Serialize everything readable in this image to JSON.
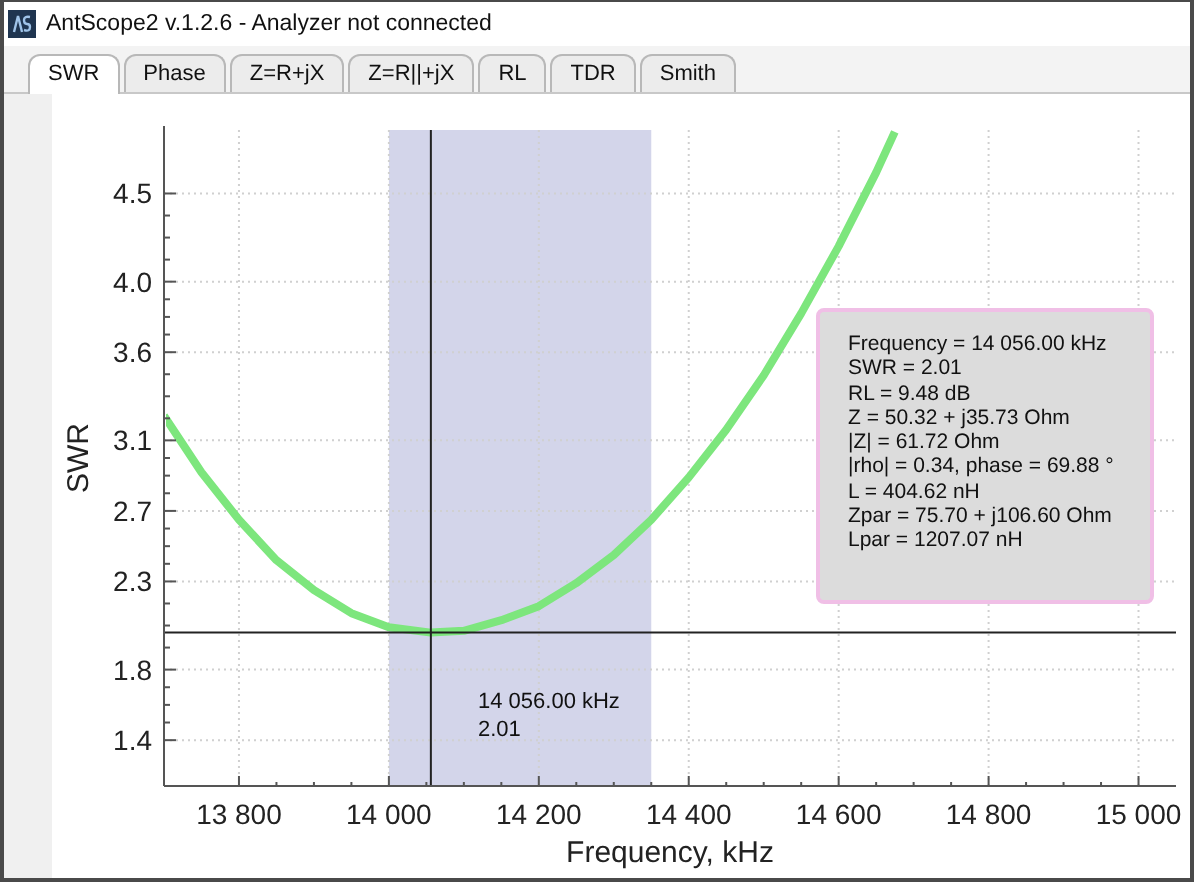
{
  "window": {
    "title": "AntScope2 v.1.2.6 - Analyzer not connected"
  },
  "tabs": [
    {
      "label": "SWR",
      "selected": true
    },
    {
      "label": "Phase",
      "selected": false
    },
    {
      "label": "Z=R+jX",
      "selected": false
    },
    {
      "label": "Z=R||+jX",
      "selected": false
    },
    {
      "label": "RL",
      "selected": false
    },
    {
      "label": "TDR",
      "selected": false
    },
    {
      "label": "Smith",
      "selected": false
    }
  ],
  "chart": {
    "chart_data": {
      "type": "line",
      "xlabel": "Frequency, kHz",
      "ylabel": "SWR",
      "x": [
        13700,
        13750,
        13800,
        13850,
        13900,
        13950,
        14000,
        14056,
        14100,
        14150,
        14200,
        14250,
        14300,
        14350,
        14400,
        14450,
        14500,
        14550,
        14600,
        14650,
        14675
      ],
      "series": [
        {
          "color": "#7de67d",
          "values": [
            3.24,
            2.92,
            2.65,
            2.42,
            2.25,
            2.12,
            2.04,
            2.01,
            2.02,
            2.08,
            2.16,
            2.29,
            2.45,
            2.65,
            2.89,
            3.16,
            3.47,
            3.82,
            4.2,
            4.62,
            4.85
          ]
        }
      ],
      "xlim": [
        13700,
        15050
      ],
      "grid": true,
      "ylim": [
        1.14,
        4.86
      ],
      "xticks": [
        {
          "value": 13800,
          "label": "13 800"
        },
        {
          "value": 14000,
          "label": "14 000"
        },
        {
          "value": 14200,
          "label": "14 200"
        },
        {
          "value": 14400,
          "label": "14 400"
        },
        {
          "value": 14600,
          "label": "14 600"
        },
        {
          "value": 14800,
          "label": "14 800"
        },
        {
          "value": 15000,
          "label": "15 000"
        }
      ],
      "yticks": [
        1.4,
        1.8,
        2.3,
        2.7,
        3.1,
        3.6,
        {
          "value": 4,
          "label": "4.0"
        },
        4.5
      ],
      "bands": [
        {
          "axis": "x",
          "from": 14000,
          "to": 14350
        }
      ],
      "ref_lines": [
        {
          "axis": "x",
          "value": 14056
        },
        {
          "axis": "y",
          "value": 2.01
        }
      ]
    },
    "marker_label": [
      "14 056.00 kHz",
      "2.01"
    ],
    "readout": [
      "Frequency = 14 056.00 kHz",
      "SWR = 2.01",
      "RL = 9.48 dB",
      "Z = 50.32 + j35.73 Ohm",
      "|Z| = 61.72 Ohm",
      "|rho| = 0.34, phase = 69.88 °",
      "L = 404.62 nH",
      "Zpar = 75.70 + j106.60 Ohm",
      "Lpar = 1207.07 nH"
    ]
  }
}
